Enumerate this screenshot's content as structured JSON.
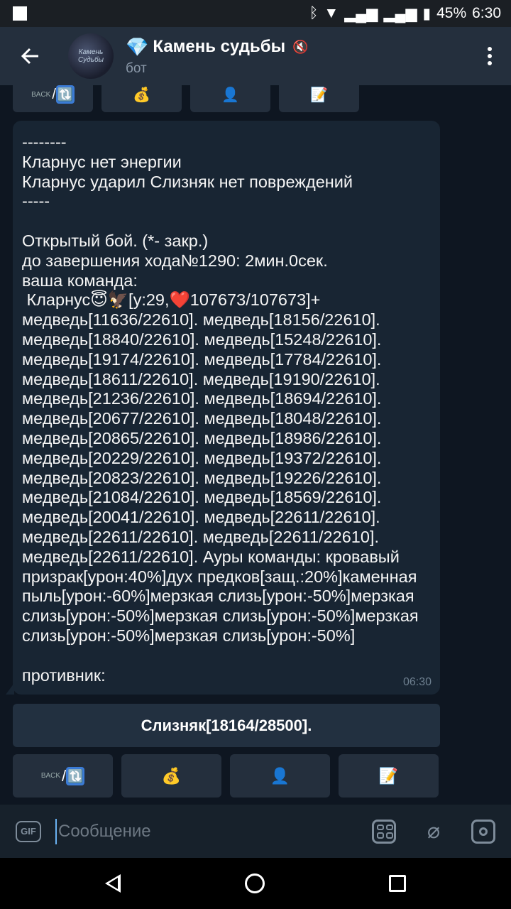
{
  "status_bar": {
    "battery": "45%",
    "time": "6:30"
  },
  "header": {
    "title": "Камень судьбы",
    "subtitle": "бот",
    "avatar_text": "Камень Судьбы"
  },
  "keyboard_top": {
    "back_label": "BACK",
    "slash": "/",
    "refresh": "🔃",
    "money": "💰",
    "user": "👤",
    "note": "📝"
  },
  "message": {
    "text": "--------\nКларнус нет энергии\nКларнус ударил Слизняк нет повреждений\n-----\n\nОткрытый бой. (*- закр.)\nдо завершения хода№1290: 2мин.0сек.\nваша команда:\n Кларнус😇🦅[у:29,❤️107673/107673]+\nмедведь[11636/22610]. медведь[18156/22610].\nмедведь[18840/22610]. медведь[15248/22610].\nмедведь[19174/22610]. медведь[17784/22610].\nмедведь[18611/22610]. медведь[19190/22610].\nмедведь[21236/22610]. медведь[18694/22610].\nмедведь[20677/22610]. медведь[18048/22610].\nмедведь[20865/22610]. медведь[18986/22610].\nмедведь[20229/22610]. медведь[19372/22610].\nмедведь[20823/22610]. медведь[19226/22610].\nмедведь[21084/22610]. медведь[18569/22610].\nмедведь[20041/22610]. медведь[22611/22610].\nмедведь[22611/22610]. медведь[22611/22610].\nмедведь[22611/22610]. Ауры команды: кровавый\nпризрак[урон:40%]дух предков[защ.:20%]каменная\nпыль[урон:-60%]мерзкая слизь[урон:-50%]мерзкая\nслизь[урон:-50%]мерзкая слизь[урон:-50%]мерзкая\nслизь[урон:-50%]мерзкая слизь[урон:-50%]\n\nпротивник:",
    "time": "06:30"
  },
  "inline_button": {
    "label": "Слизняк[18164/28500]."
  },
  "keyboard_bottom": {
    "back_label": "BACK",
    "slash": "/",
    "refresh": "🔃",
    "money": "💰",
    "user": "👤",
    "note": "📝"
  },
  "input": {
    "placeholder": "Сообщение",
    "gif_label": "GIF"
  }
}
